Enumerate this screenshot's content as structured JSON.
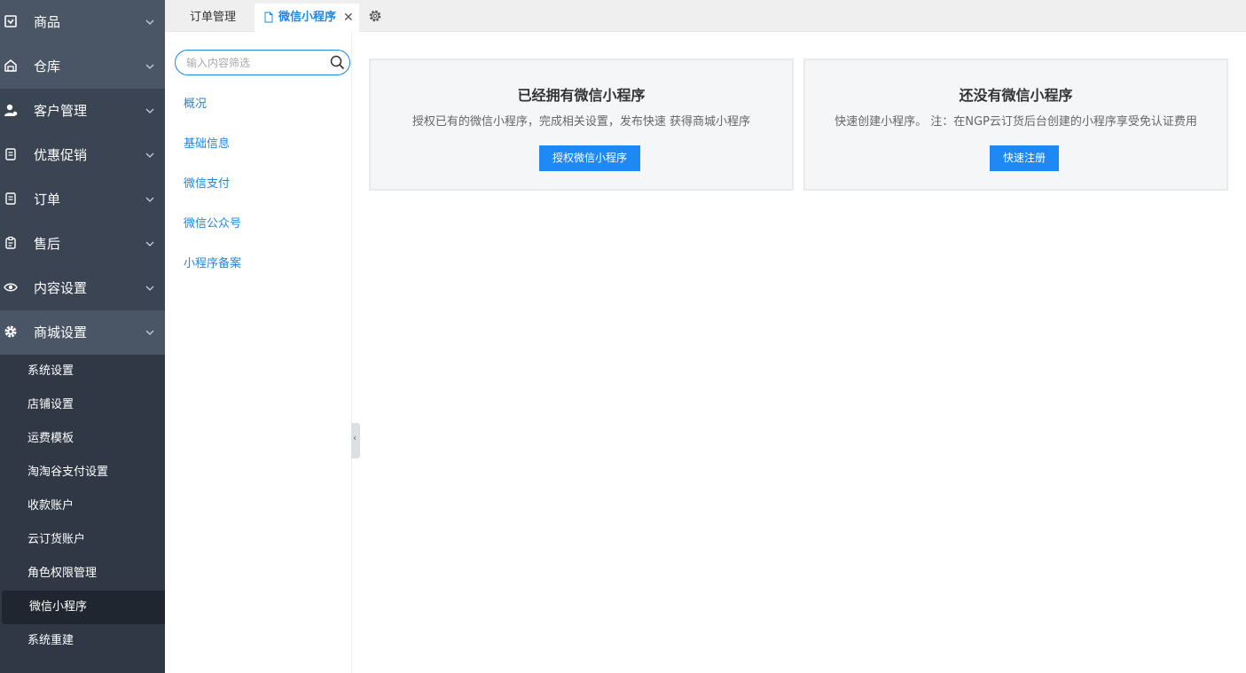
{
  "sidebar": {
    "groups": [
      {
        "label": "商品",
        "icon": "product-icon"
      },
      {
        "label": "仓库",
        "icon": "warehouse-icon"
      },
      {
        "label": "客户管理",
        "icon": "customer-icon"
      },
      {
        "label": "优惠促销",
        "icon": "promotion-icon"
      },
      {
        "label": "订单",
        "icon": "order-icon"
      },
      {
        "label": "售后",
        "icon": "after-sales-icon"
      },
      {
        "label": "内容设置",
        "icon": "eye-icon"
      },
      {
        "label": "商城设置",
        "icon": "gear-icon"
      }
    ],
    "subitems": [
      "系统设置",
      "店铺设置",
      "运费模板",
      "淘淘谷支付设置",
      "收款账户",
      "云订货账户",
      "角色权限管理",
      "微信小程序",
      "系统重建"
    ],
    "current_subitem": "微信小程序"
  },
  "tabs": {
    "plain": "订单管理",
    "active": "微信小程序",
    "close_glyph": "✕"
  },
  "subnav": {
    "search_placeholder": "输入内容筛选",
    "links": [
      "概况",
      "基础信息",
      "微信支付",
      "微信公众号",
      "小程序备案"
    ],
    "collapse_glyph": "‹"
  },
  "cards": {
    "have": {
      "title": "已经拥有微信小程序",
      "desc": "授权已有的微信小程序，完成相关设置，发布快速 获得商城小程序",
      "button": "授权微信小程序"
    },
    "none": {
      "title": "还没有微信小程序",
      "desc": "快速创建小程序。 注：在NGP云订货后台创建的小程序享受免认证费用",
      "button": "快速注册"
    }
  },
  "colors": {
    "sidebar_bg": "#3a4452",
    "accent": "#1e88e5",
    "button": "#1e88f5"
  }
}
